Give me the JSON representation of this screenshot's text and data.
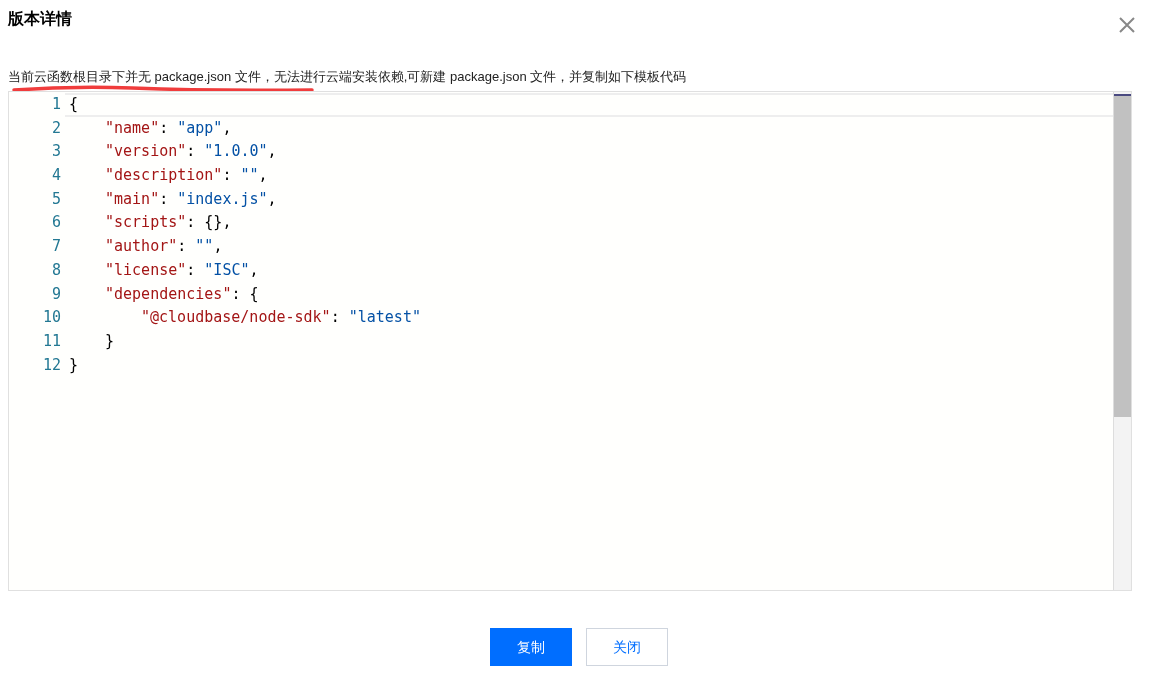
{
  "dialog": {
    "title": "版本详情",
    "notice": "当前云函数根目录下并无 package.json 文件，无法进行云端安装依赖,可新建 package.json 文件，并复制如下模板代码"
  },
  "editor": {
    "lines": [
      {
        "number": "1",
        "current": true,
        "tokens": [
          {
            "kind": "punct",
            "text": "{"
          }
        ],
        "children": [
          {
            "number": "2",
            "current": false,
            "tokens": [
              {
                "kind": "key",
                "text": "\"name\""
              },
              {
                "kind": "punct",
                "text": ": "
              },
              {
                "kind": "string",
                "text": "\"app\""
              },
              {
                "kind": "punct",
                "text": ","
              }
            ]
          },
          {
            "number": "3",
            "current": false,
            "tokens": [
              {
                "kind": "key",
                "text": "\"version\""
              },
              {
                "kind": "punct",
                "text": ": "
              },
              {
                "kind": "string",
                "text": "\"1.0.0\""
              },
              {
                "kind": "punct",
                "text": ","
              }
            ]
          },
          {
            "number": "4",
            "current": false,
            "tokens": [
              {
                "kind": "key",
                "text": "\"description\""
              },
              {
                "kind": "punct",
                "text": ": "
              },
              {
                "kind": "string",
                "text": "\"\""
              },
              {
                "kind": "punct",
                "text": ","
              }
            ]
          },
          {
            "number": "5",
            "current": false,
            "tokens": [
              {
                "kind": "key",
                "text": "\"main\""
              },
              {
                "kind": "punct",
                "text": ": "
              },
              {
                "kind": "string",
                "text": "\"index.js\""
              },
              {
                "kind": "punct",
                "text": ","
              }
            ]
          },
          {
            "number": "6",
            "current": false,
            "tokens": [
              {
                "kind": "key",
                "text": "\"scripts\""
              },
              {
                "kind": "punct",
                "text": ": {},"
              }
            ]
          },
          {
            "number": "7",
            "current": false,
            "tokens": [
              {
                "kind": "key",
                "text": "\"author\""
              },
              {
                "kind": "punct",
                "text": ": "
              },
              {
                "kind": "string",
                "text": "\"\""
              },
              {
                "kind": "punct",
                "text": ","
              }
            ]
          },
          {
            "number": "8",
            "current": false,
            "tokens": [
              {
                "kind": "key",
                "text": "\"license\""
              },
              {
                "kind": "punct",
                "text": ": "
              },
              {
                "kind": "string",
                "text": "\"ISC\""
              },
              {
                "kind": "punct",
                "text": ","
              }
            ]
          },
          {
            "number": "9",
            "current": false,
            "tokens": [
              {
                "kind": "key",
                "text": "\"dependencies\""
              },
              {
                "kind": "punct",
                "text": ": {"
              }
            ],
            "children": [
              {
                "number": "10",
                "current": false,
                "tokens": [
                  {
                    "kind": "key",
                    "text": "\"@cloudbase/node-sdk\""
                  },
                  {
                    "kind": "punct",
                    "text": ": "
                  },
                  {
                    "kind": "string",
                    "text": "\"latest\""
                  }
                ]
              }
            ]
          },
          {
            "number": "11",
            "current": false,
            "tokens": [
              {
                "kind": "punct",
                "text": "}"
              }
            ]
          }
        ]
      },
      {
        "number": "12",
        "current": false,
        "tokens": [
          {
            "kind": "punct",
            "text": "}"
          }
        ]
      }
    ]
  },
  "buttons": [
    {
      "label": "复制",
      "kind": "primary"
    },
    {
      "label": "关闭",
      "kind": "secondary"
    }
  ]
}
